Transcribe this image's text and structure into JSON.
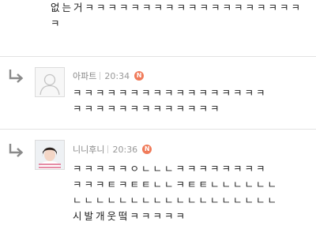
{
  "top_comment": {
    "text": "없는거ㅋㅋㅋㅋㅋㅋㅋㅋㅋㅋㅋㅋㅋㅋㅋㅋㅋㅋㅋ\nㅋ"
  },
  "replies": [
    {
      "nickname": "아파트",
      "time": "20:34",
      "badge": "N",
      "text": "ㅋㅋㅋㅋㅋㅋㅋㅋㅋㅋㅋㅋㅋㅋㅋㅋㅋ\nㅋㅋㅋㅋㅋㅋㅋㅋㅋㅋㅋㅋㅋ"
    },
    {
      "nickname": "니니후니",
      "time": "20:36",
      "badge": "N",
      "text": "ㅋㅋㅋㅋㅋㅇㄴㄴㄴㅋㅋㅋㅋㅋㅋㅋㅋ\nㅋㅋㅋㅌㅋㅌㅌㄴㄴㅋㅌㅌㄴㄴㄴㄴㄴㄴ\nㄴㄴㄴㄴㄴㄴㄴㄴㄴㄴㄴㄴㄴㄴㄴㄴㄴㄴ\n시발개웃떸ㅋㅋㅋㅋㅋ"
    }
  ],
  "icons": {
    "reply_arrow": "reply-arrow-icon",
    "default_avatar": "default-avatar-icon"
  },
  "colors": {
    "badge": "#f07b5a",
    "divider": "#e2e2e2",
    "meta_text": "#8a8a8a"
  }
}
